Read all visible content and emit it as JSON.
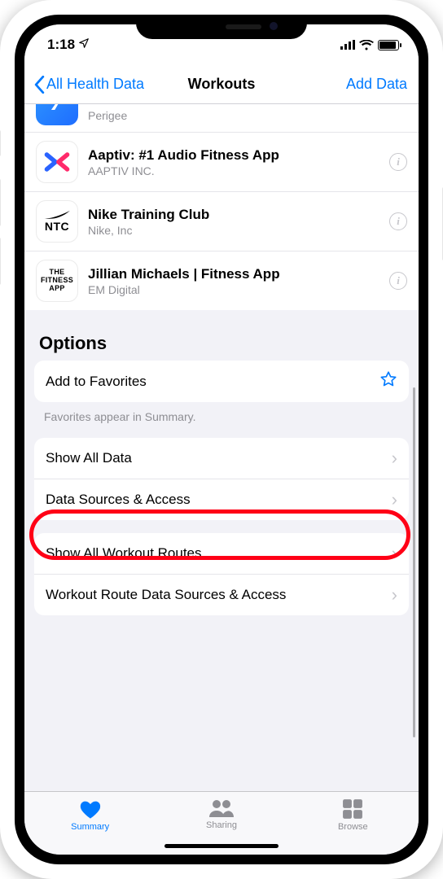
{
  "status": {
    "time": "1:18"
  },
  "nav": {
    "back": "All Health Data",
    "title": "Workouts",
    "action": "Add Data"
  },
  "apps": [
    {
      "name": "",
      "publisher": "Perigee",
      "icon": "seven"
    },
    {
      "name": "Aaptiv: #1 Audio Fitness App",
      "publisher": "AAPTIV INC.",
      "icon": "aaptiv"
    },
    {
      "name": "Nike Training Club",
      "publisher": "Nike, Inc",
      "icon": "ntc"
    },
    {
      "name": "Jillian Michaels | Fitness App",
      "publisher": "EM Digital",
      "icon": "jm"
    }
  ],
  "options": {
    "header": "Options",
    "favorites": "Add to Favorites",
    "favorites_note": "Favorites appear in Summary.",
    "show_all_data": "Show All Data",
    "data_sources": "Data Sources & Access",
    "show_routes": "Show All Workout Routes",
    "route_sources": "Workout Route Data Sources & Access"
  },
  "tabs": {
    "summary": "Summary",
    "sharing": "Sharing",
    "browse": "Browse"
  },
  "highlighted": "show_all_data"
}
